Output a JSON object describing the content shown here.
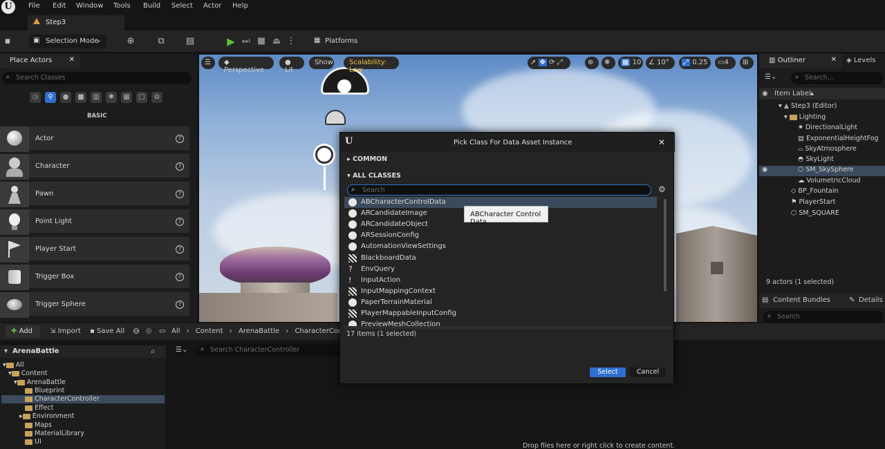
{
  "menu": [
    "File",
    "Edit",
    "Window",
    "Tools",
    "Build",
    "Select",
    "Actor",
    "Help"
  ],
  "doc_tab": "Step3",
  "toolbar": {
    "selection_mode": "Selection Mode",
    "platforms": "Platforms"
  },
  "place_actors": {
    "tab": "Place Actors",
    "search_placeholder": "Search Classes",
    "category": "BASIC",
    "items": [
      "Actor",
      "Character",
      "Pawn",
      "Point Light",
      "Player Start",
      "Trigger Box",
      "Trigger Sphere"
    ]
  },
  "viewport": {
    "perspective": "Perspective",
    "lit": "Lit",
    "show": "Show",
    "scalability": "Scalability: Low",
    "grid_snap": "10",
    "rot_snap": "10°",
    "scale_snap": "0.25",
    "cam_speed": "4"
  },
  "outliner": {
    "tab": "Outliner",
    "levels_tab": "Levels",
    "search_placeholder": "Search...",
    "column": "Item Label",
    "rows": [
      "Step3 (Editor)",
      "Lighting",
      "DirectionalLight",
      "ExponentialHeightFog",
      "SkyAtmosphere",
      "SkyLight",
      "SM_SkySphere",
      "VolumetricCloud",
      "BP_Fountain",
      "PlayerStart",
      "SM_SQUARE"
    ],
    "status": "9 actors (1 selected)",
    "content_bundles": "Content Bundles",
    "details": "Details",
    "search2": "Search"
  },
  "content_browser": {
    "add": "Add",
    "import": "Import",
    "save_all": "Save All",
    "breadcrumb": [
      "All",
      "Content",
      "ArenaBattle",
      "CharacterContr"
    ],
    "root": "ArenaBattle",
    "filter_placeholder": "Search CharacterController",
    "tree": [
      "All",
      "Content",
      "ArenaBattle",
      "Blueprint",
      "CharacterController",
      "Effect",
      "Environment",
      "Maps",
      "MaterialLibrary",
      "UI"
    ],
    "drop_hint": "Drop files here or right click to create content."
  },
  "modal": {
    "title": "Pick Class For Data Asset Instance",
    "common": "COMMON",
    "all_classes": "ALL CLASSES",
    "search_placeholder": "Search",
    "classes": [
      "ABCharacterControlData",
      "ARCandidateImage",
      "ARCandidateObject",
      "ARSessionConfig",
      "AutomationViewSettings",
      "BlackboardData",
      "EnvQuery",
      "InputAction",
      "InputMappingContext",
      "PaperTerrainMaterial",
      "PlayerMappableInputConfig",
      "PreviewMeshCollection"
    ],
    "count": "17 items (1 selected)",
    "select": "Select",
    "cancel": "Cancel",
    "tooltip": "ABCharacter Control Data"
  }
}
